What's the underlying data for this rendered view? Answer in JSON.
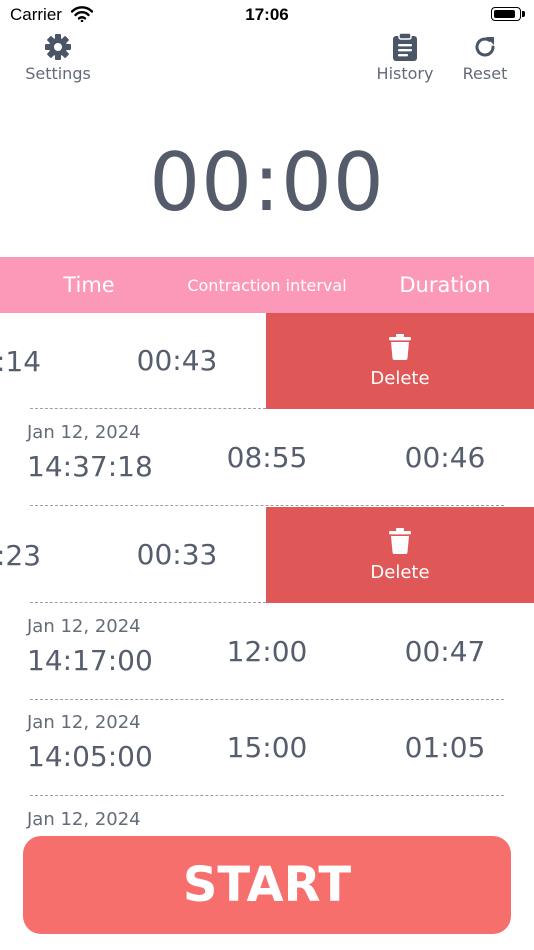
{
  "status_bar": {
    "carrier": "Carrier",
    "time": "17:06",
    "battery_level": 0.95
  },
  "toolbar": {
    "settings_label": "Settings",
    "history_label": "History",
    "reset_label": "Reset"
  },
  "timer": {
    "display": "00:00"
  },
  "table": {
    "headers": {
      "time": "Time",
      "interval": "Contraction interval",
      "duration": "Duration"
    },
    "delete_label": "Delete",
    "rows": [
      {
        "time_partial": ":14",
        "interval": "00:43",
        "swiped": true
      },
      {
        "date": "Jan 12, 2024",
        "time": "14:37:18",
        "interval": "08:55",
        "duration": "00:46"
      },
      {
        "time_partial": ":23",
        "interval": "00:33",
        "swiped": true
      },
      {
        "date": "Jan 12, 2024",
        "time": "14:17:00",
        "interval": "12:00",
        "duration": "00:47"
      },
      {
        "date": "Jan 12, 2024",
        "time": "14:05:00",
        "interval": "15:00",
        "duration": "01:05"
      },
      {
        "date": "Jan 12, 2024"
      }
    ]
  },
  "start_button": {
    "label": "START"
  },
  "colors": {
    "header_bg": "#fc99b8",
    "delete_bg": "#e05757",
    "start_bg": "#f76f6c",
    "text": "#565d6d"
  }
}
